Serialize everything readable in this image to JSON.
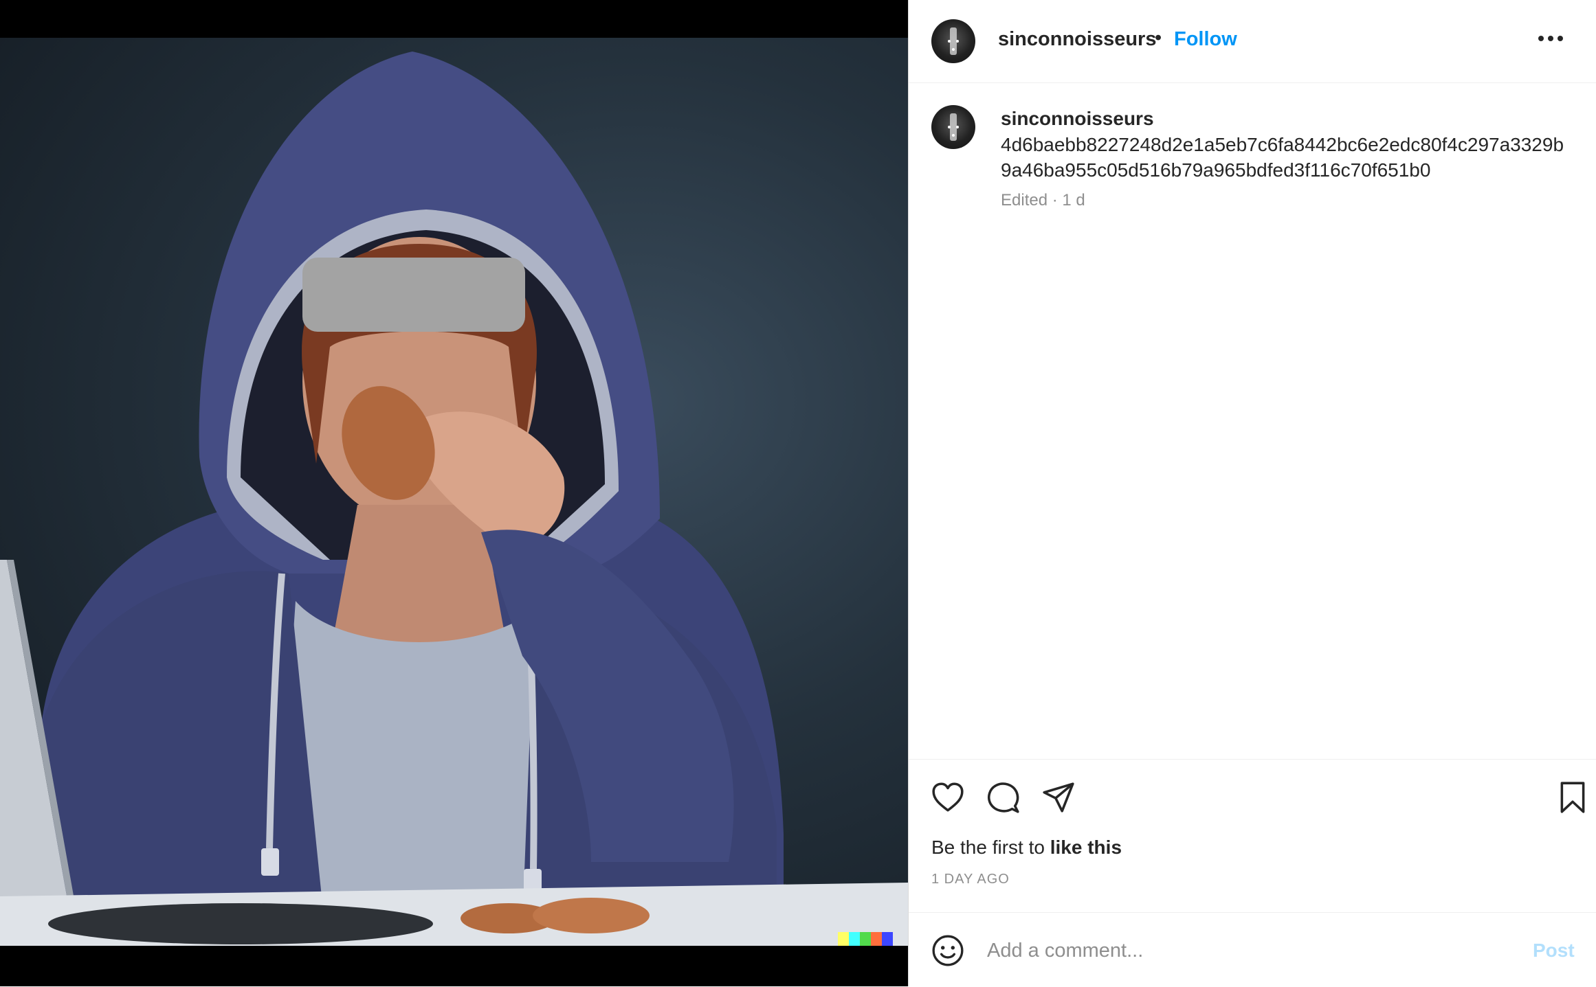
{
  "post": {
    "author": {
      "username": "sinconnoisseurs",
      "separator": "•",
      "follow_label": "Follow"
    },
    "caption": {
      "username": "sinconnoisseurs",
      "text": "4d6baebb8227248d2e1a5eb7c6fa8442bc6e2edc80f4c297a3329b9a46ba955c05d516b79a965bdfed3f116c70f651b0",
      "meta": "Edited · 1 d"
    },
    "actions": {
      "like_icon": "heart-icon",
      "comment_icon": "comment-bubble-icon",
      "share_icon": "paper-plane-icon",
      "save_icon": "bookmark-icon",
      "more_icon": "more-horizontal-icon"
    },
    "likes": {
      "prefix": "Be the first to ",
      "emphasis": "like this"
    },
    "timestamp": "1 DAY AGO",
    "comment_box": {
      "emoji_icon": "smiley-icon",
      "placeholder": "Add a comment...",
      "post_label": "Post"
    },
    "colors": {
      "accent": "#0095f6",
      "post_disabled": "#b2dffc",
      "text": "#262626",
      "muted": "#8e8e8e"
    }
  }
}
